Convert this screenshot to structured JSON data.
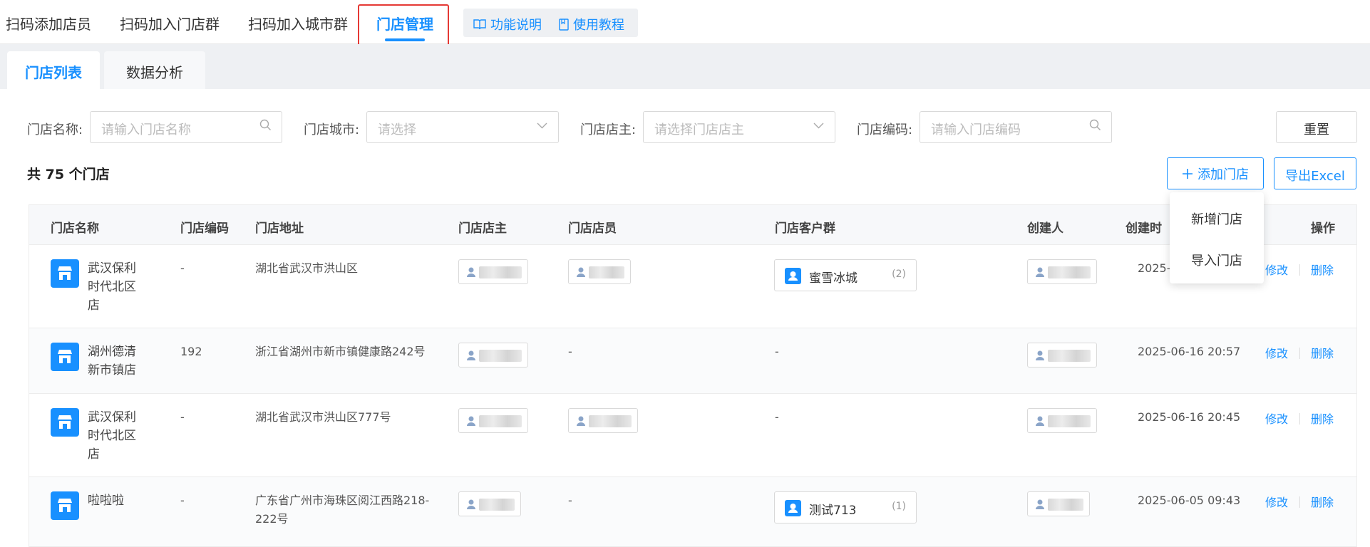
{
  "top_tabs": [
    "扫码添加店员",
    "扫码加入门店群",
    "扫码加入城市群",
    "门店管理"
  ],
  "help_buttons": [
    "功能说明",
    "使用教程"
  ],
  "sub_tabs": [
    "门店列表",
    "数据分析"
  ],
  "filters": {
    "name_label": "门店名称:",
    "name_placeholder": "请输入门店名称",
    "city_label": "门店城市:",
    "city_placeholder": "请选择",
    "owner_label": "门店店主:",
    "owner_placeholder": "请选择门店店主",
    "code_label": "门店编码:",
    "code_placeholder": "请输入门店编码",
    "reset": "重置"
  },
  "summary": "共 75 个门店",
  "actions": {
    "add": "添加门店",
    "export": "导出Excel"
  },
  "dropdown": [
    "新增门店",
    "导入门店"
  ],
  "columns": [
    "门店名称",
    "门店编码",
    "门店地址",
    "门店店主",
    "门店店员",
    "门店客户群",
    "创建人",
    "创建时",
    "操作"
  ],
  "rows": [
    {
      "name": "武汉保利时代北区店",
      "code": "-",
      "address": "湖北省武汉市洪山区",
      "staff": "",
      "group": "蜜雪冰城",
      "group_count": "(2)",
      "time": "2025-0",
      "edit": "修改",
      "del": "删除"
    },
    {
      "name": "湖州德清新市镇店",
      "code": "192",
      "address": "浙江省湖州市新市镇健康路242号",
      "staff": "-",
      "group": "-",
      "group_count": "",
      "time": "2025-06-16 20:57",
      "edit": "修改",
      "del": "删除"
    },
    {
      "name": "武汉保利时代北区店",
      "code": "-",
      "address": "湖北省武汉市洪山区777号",
      "staff": "",
      "group": "-",
      "group_count": "",
      "time": "2025-06-16 20:45",
      "edit": "修改",
      "del": "删除"
    },
    {
      "name": "啦啦啦",
      "code": "-",
      "address": "广东省广州市海珠区阅江西路218-222号",
      "staff": "-",
      "group": "测试713",
      "group_count": "(1)",
      "time": "2025-06-05 09:43",
      "edit": "修改",
      "del": "删除"
    }
  ]
}
